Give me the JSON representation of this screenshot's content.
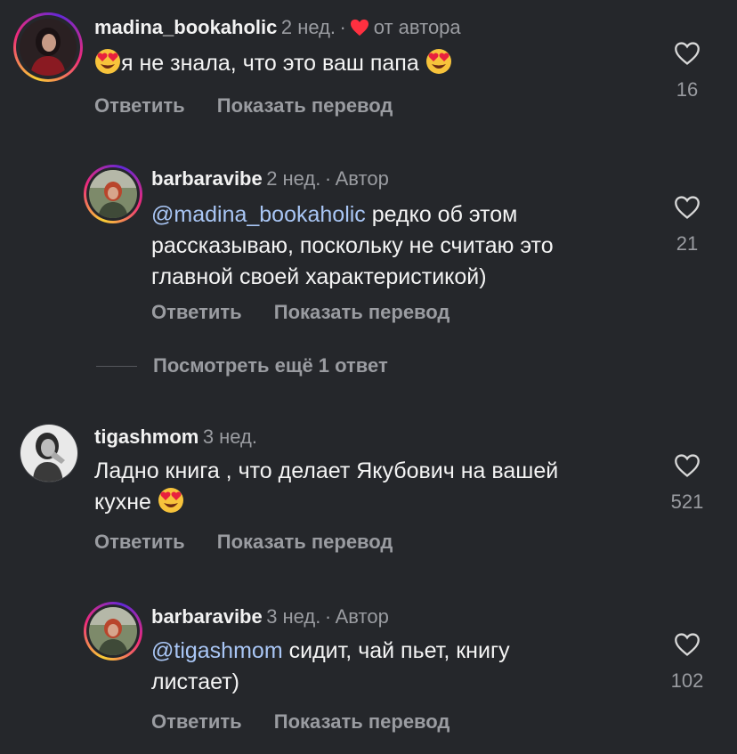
{
  "comments": [
    {
      "username": "madina_bookaholic",
      "time": "2 нед.",
      "separator": "·",
      "author_like_label": "от автора",
      "text": "я не знала, что это ваш папа",
      "reply_label": "Ответить",
      "translate_label": "Показать перевод",
      "likes": "16",
      "avatar": "avatar-woman-red-top"
    },
    {
      "username": "barbaravibe",
      "time": "2 нед.",
      "separator": "·",
      "author_tag": "Автор",
      "mention": "@madina_bookaholic",
      "text_line1": " редко об этом",
      "text_line2": "рассказываю, поскольку не считаю это",
      "text_line3": "главной своей характеристикой)",
      "reply_label": "Ответить",
      "translate_label": "Показать перевод",
      "likes": "21",
      "avatar": "avatar-redhead-landscape"
    },
    {
      "username": "tigashmom",
      "time": "3 нед.",
      "text_line1": "Ладно книга , что делает Якубович на вашей",
      "text_line2": "кухне",
      "reply_label": "Ответить",
      "translate_label": "Показать перевод",
      "likes": "521",
      "avatar": "avatar-bw-woman"
    },
    {
      "username": "barbaravibe",
      "time": "3 нед.",
      "separator": "·",
      "author_tag": "Автор",
      "mention": "@tigashmom",
      "text_line1": " сидит, чай пьет, книгу",
      "text_line2": "листает)",
      "reply_label": "Ответить",
      "translate_label": "Показать перевод",
      "likes": "102",
      "avatar": "avatar-redhead-landscape"
    }
  ],
  "more_replies_label": "Посмотреть ещё 1 ответ",
  "colors": {
    "background": "#25272b",
    "mention": "#a9c6f5",
    "heart": "#ff3040",
    "muted": "#9a9ca1"
  },
  "icons": {
    "like": "heart-outline-icon",
    "author_like": "heart-filled-icon",
    "emoji": "heart-eyes-emoji"
  }
}
